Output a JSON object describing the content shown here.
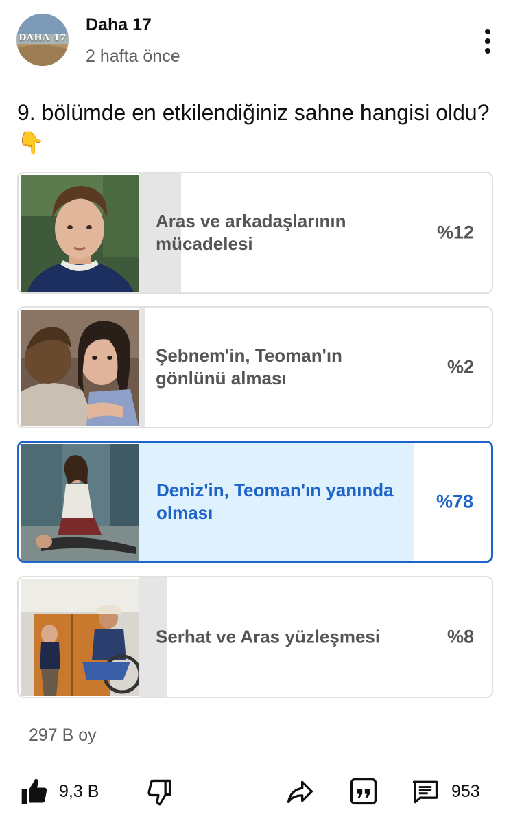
{
  "post": {
    "channel": "Daha 17",
    "avatar_text": "DAHA 17",
    "time": "2 hafta önce",
    "question": "9. bölümde en etkilendiğiniz sahne hangisi oldu? 👇"
  },
  "poll": {
    "options": [
      {
        "label": "Aras ve arkadaşlarının mücadelesi",
        "percent_label": "%12",
        "percent": 12,
        "selected": false
      },
      {
        "label": "Şebnem'in, Teoman'ın gönlünü alması",
        "percent_label": "%2",
        "percent": 2,
        "selected": false
      },
      {
        "label": "Deniz'in, Teoman'ın yanında olması",
        "percent_label": "%78",
        "percent": 78,
        "selected": true
      },
      {
        "label": "Serhat ve Aras yüzleşmesi",
        "percent_label": "%8",
        "percent": 8,
        "selected": false
      }
    ],
    "votes": "297 B oy"
  },
  "actions": {
    "likes": "9,3 B",
    "comments": "953"
  },
  "colors": {
    "accent": "#1e63c9",
    "selected_fill": "#def1fd",
    "bar_fill": "#e5e5e5",
    "border": "#e0e0e0"
  },
  "icons": [
    "more-vert-icon",
    "point-down-emoji",
    "thumb-up-icon",
    "thumb-down-icon",
    "share-icon",
    "quote-icon",
    "comment-icon"
  ]
}
